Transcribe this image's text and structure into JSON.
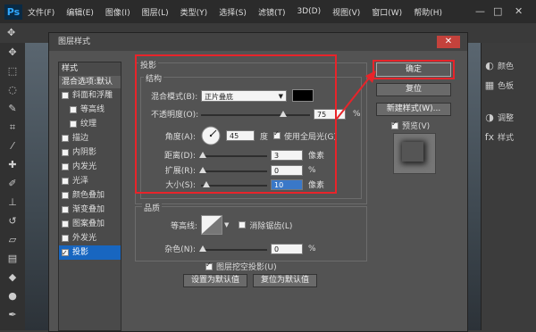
{
  "app": {
    "logo": "Ps"
  },
  "menu": [
    "文件(F)",
    "编辑(E)",
    "图像(I)",
    "图层(L)",
    "类型(Y)",
    "选择(S)",
    "滤镜(T)",
    "3D(D)",
    "视图(V)",
    "窗口(W)",
    "帮助(H)"
  ],
  "window_controls": {
    "minimize": "—",
    "maximize": "□",
    "close": "✕"
  },
  "right_panel": [
    {
      "icon": "palette-icon",
      "glyph": "◐",
      "label": "颜色"
    },
    {
      "icon": "swatches-icon",
      "glyph": "▦",
      "label": "色板"
    },
    {
      "icon": "adjust-icon",
      "glyph": "◑",
      "label": "调整"
    },
    {
      "icon": "styles-icon",
      "glyph": "fx",
      "label": "样式"
    }
  ],
  "dialog": {
    "title": "图层样式",
    "close": "✕",
    "styles_header": "样式",
    "blend_default": "混合选项:默认",
    "styles": [
      {
        "label": "斜面和浮雕",
        "checked": false,
        "indent": false,
        "checkbox": true
      },
      {
        "label": "等高线",
        "checked": false,
        "indent": true,
        "checkbox": true
      },
      {
        "label": "纹理",
        "checked": false,
        "indent": true,
        "checkbox": true
      },
      {
        "label": "描边",
        "checked": false,
        "indent": false,
        "checkbox": true
      },
      {
        "label": "内阴影",
        "checked": false,
        "indent": false,
        "checkbox": true
      },
      {
        "label": "内发光",
        "checked": false,
        "indent": false,
        "checkbox": true
      },
      {
        "label": "光泽",
        "checked": false,
        "indent": false,
        "checkbox": true
      },
      {
        "label": "颜色叠加",
        "checked": false,
        "indent": false,
        "checkbox": true
      },
      {
        "label": "渐变叠加",
        "checked": false,
        "indent": false,
        "checkbox": true
      },
      {
        "label": "图案叠加",
        "checked": false,
        "indent": false,
        "checkbox": true
      },
      {
        "label": "外发光",
        "checked": false,
        "indent": false,
        "checkbox": true
      },
      {
        "label": "投影",
        "checked": true,
        "indent": false,
        "checkbox": true,
        "active": true
      }
    ],
    "drop_shadow": {
      "title": "投影",
      "structure": "结构",
      "blend_mode_label": "混合模式(B):",
      "blend_mode_value": "正片叠底",
      "shadow_color": "#000000",
      "opacity_label": "不透明度(O):",
      "opacity_value": "75",
      "opacity_unit": "%",
      "angle_label": "角度(A):",
      "angle_value": "45",
      "angle_unit": "度",
      "global_light_label": "使用全局光(G)",
      "global_light_checked": true,
      "distance_label": "距离(D):",
      "distance_value": "3",
      "distance_unit": "像素",
      "spread_label": "扩展(R):",
      "spread_value": "0",
      "spread_unit": "%",
      "size_label": "大小(S):",
      "size_value": "10",
      "size_unit": "像素",
      "quality": "品质",
      "contour_label": "等高线:",
      "antialias_label": "消除锯齿(L)",
      "antialias_checked": false,
      "noise_label": "杂色(N):",
      "noise_value": "0",
      "noise_unit": "%",
      "knockout_label": "图层挖空投影(U)",
      "knockout_checked": true,
      "make_default": "设置为默认值",
      "reset_default": "复位为默认值"
    },
    "buttons": {
      "ok": "确定",
      "reset": "复位",
      "new_style": "新建样式(W)...",
      "preview": "预览(V)"
    },
    "preview_checked": true
  }
}
